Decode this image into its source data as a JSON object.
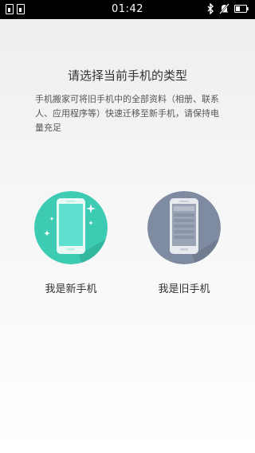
{
  "status_bar": {
    "time": "01:42",
    "left_icons": [
      "sim-card-icon",
      "sim-card-icon"
    ],
    "right_icons": [
      "bluetooth-icon",
      "mute-icon",
      "battery-icon"
    ]
  },
  "main": {
    "title": "请选择当前手机的类型",
    "description": "手机搬家可将旧手机中的全部资料（相册、联系人、应用程序等）快速迁移至新手机，请保持电量充足"
  },
  "options": {
    "new_phone": {
      "label": "我是新手机",
      "icon": "new-phone-icon",
      "color": "#3ecbb3"
    },
    "old_phone": {
      "label": "我是旧手机",
      "icon": "old-phone-icon",
      "color": "#7f8ba0"
    }
  },
  "colors": {
    "status_bar_bg": "#000000",
    "background_top": "#eeeeee",
    "background_bottom": "#ffffff",
    "new_phone_accent": "#3ecbb3",
    "old_phone_accent": "#7f8ba0"
  }
}
